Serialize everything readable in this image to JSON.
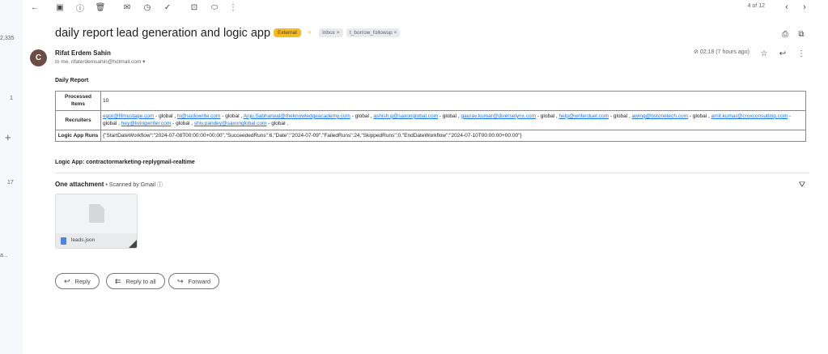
{
  "rail": {
    "count_top": "2,335",
    "count_1": "1",
    "count_2": "17",
    "trunc": "a..."
  },
  "toolbar": {
    "pager": "4 of 12"
  },
  "email": {
    "subject": "daily report lead generation and logic app runs",
    "labels": {
      "external": "External",
      "inbox": "Inbox ×",
      "followup": "t_borrow_followup ×"
    },
    "sender": {
      "initial": "C",
      "name": "Rifat Erdem Sahin",
      "to": "to me, rifaterdemsahin@hotmail.com ▾"
    },
    "time": "02:18 (7 hours ago)",
    "body_title": "Daily Report",
    "table": {
      "processed_label": "Processed Items",
      "processed_value": "10",
      "recruiters_label": "Recruiters",
      "recruiters": [
        {
          "email": "egor@filmustage.com",
          "sep": " - global , "
        },
        {
          "email": "hi@sudowrite.com",
          "sep": " - global , "
        },
        {
          "email": "Anju.Sabharwal@theknowledgeacademy.com",
          "sep": " - global , "
        },
        {
          "email": "ashish.g@saxonglobal.com",
          "sep": " - global , "
        },
        {
          "email": "gaurav.kumar@diverselynx.com",
          "sep": " - global , "
        },
        {
          "email": "help@writerduet.com",
          "sep": " - global , "
        },
        {
          "email": "awing@bstonetech.com",
          "sep": " - global , "
        },
        {
          "email": "amit.kumar@croxconsulting.com",
          "sep": " - global , "
        },
        {
          "email": "hey@livingwriter.com",
          "sep": " - global , "
        },
        {
          "email": "shiv.pandey@saxonglobal.com",
          "sep": " - global ,"
        }
      ],
      "logic_label": "Logic App Runs",
      "logic_value": "{\"StartDateWorkflow\":\"2024-07-08T00:00:00+00:00\",\"SucceededRuns\":6,\"Date\":\"2024-07-09\",\"FailedRuns\":24,\"SkippedRuns\":0,\"EndDateWorkflow\":\"2024-07-10T00:00:00+00:00\"}"
    },
    "logic_app": "Logic App: contractormarketing-replygmail-realtime",
    "attachments": {
      "heading": "One attachment",
      "scanned": " • Scanned by Gmail ⓘ",
      "file_name": "leads.json"
    },
    "actions": {
      "reply": "Reply",
      "reply_all": "Reply to all",
      "forward": "Forward"
    }
  },
  "colors": {
    "external_label": "#f6bb1e",
    "link": "#1a73e8",
    "avatar": "#6d4c41"
  }
}
